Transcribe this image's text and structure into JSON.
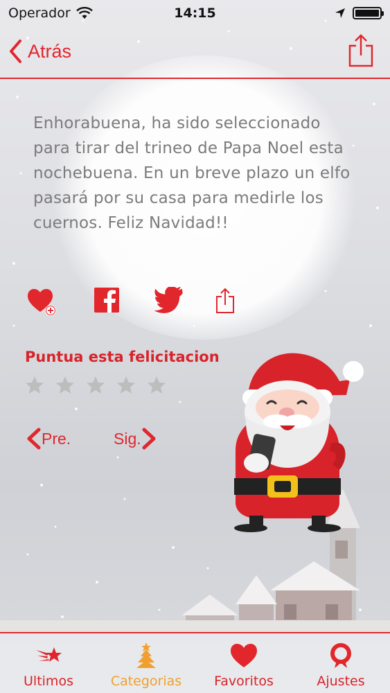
{
  "status": {
    "carrier": "Operador",
    "time": "14:15"
  },
  "nav": {
    "back_label": "Atrás"
  },
  "message": "Enhorabuena, ha sido seleccionado para tirar del trineo de Papa Noel esta nochebuena. En un breve plazo un elfo pasará por su casa para medirle los cuernos. Feliz Navidad!!",
  "rating": {
    "title": "Puntua esta felicitacion",
    "stars_total": 5,
    "stars_selected": 0
  },
  "pager": {
    "prev_label": "Pre.",
    "next_label": "Sig."
  },
  "tabs": [
    {
      "label": "Ultimos",
      "icon": "shooting-star-icon",
      "active": false
    },
    {
      "label": "Categorias",
      "icon": "tree-icon",
      "active": true
    },
    {
      "label": "Favoritos",
      "icon": "heart-icon",
      "active": false
    },
    {
      "label": "Ajustes",
      "icon": "wreath-icon",
      "active": false
    }
  ],
  "colors": {
    "accent": "#e1262c",
    "active_tab": "#f0a030",
    "text": "#7b7b7b",
    "star": "#bdbdbd"
  }
}
